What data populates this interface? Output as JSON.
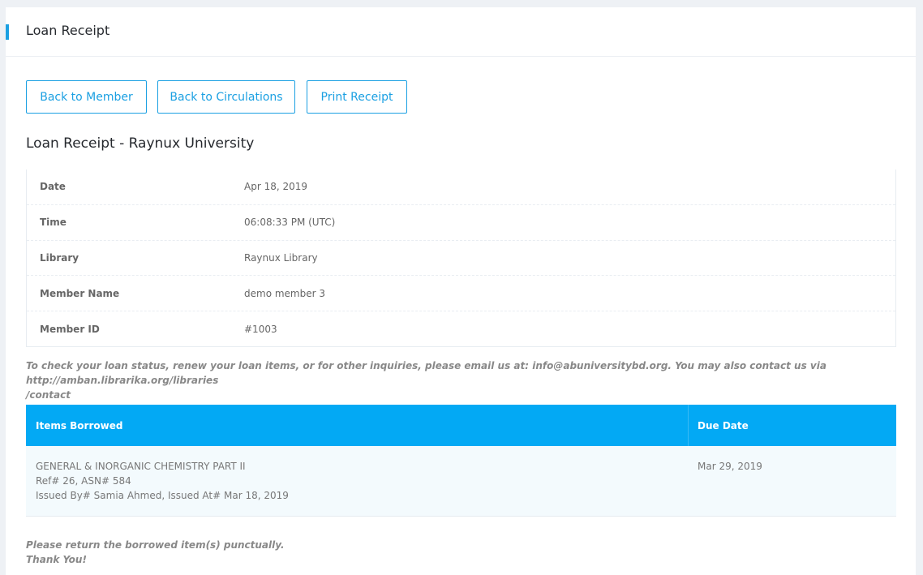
{
  "header": {
    "title": "Loan Receipt"
  },
  "buttons": {
    "back_to_member": "Back to Member",
    "back_to_circulations": "Back to Circulations",
    "print_receipt": "Print Receipt"
  },
  "receipt_title": "Loan Receipt - Raynux University",
  "info": [
    {
      "label": "Date",
      "value": "Apr 18, 2019"
    },
    {
      "label": "Time",
      "value": "06:08:33 PM (UTC)"
    },
    {
      "label": "Library",
      "value": "Raynux Library"
    },
    {
      "label": "Member Name",
      "value": "demo member 3"
    },
    {
      "label": "Member ID",
      "value": "#1003"
    }
  ],
  "notice": {
    "line1": "To check your loan status, renew your loan items, or for other inquiries, please email us at: info@abuniversitybd.org. You may also contact us via http://amban.librarika.org/libraries",
    "line2": "/contact"
  },
  "items_table": {
    "headers": {
      "items": "Items Borrowed",
      "due": "Due Date"
    },
    "rows": [
      {
        "title": "GENERAL & INORGANIC CHEMISTRY PART II",
        "ref": "Ref# 26, ASN# 584",
        "issued": "Issued By# Samia Ahmed, Issued At# Mar 18, 2019",
        "due": "Mar 29, 2019"
      }
    ]
  },
  "footer": {
    "line1": "Please return the borrowed item(s) punctually.",
    "line2": "Thank You!"
  },
  "colors": {
    "accent": "#1ba0e2",
    "table_header": "#03a9f4"
  }
}
